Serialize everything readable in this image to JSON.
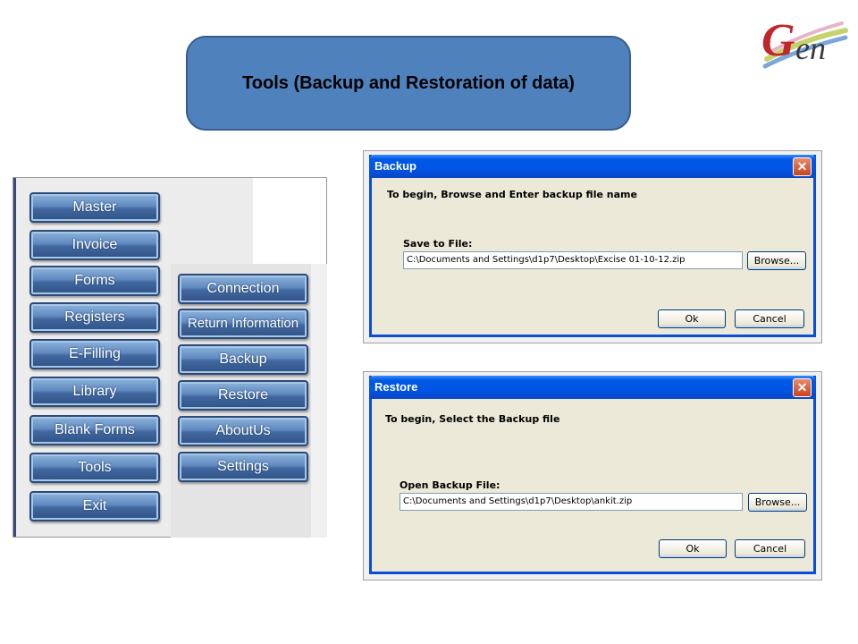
{
  "banner": {
    "title": "Tools (Backup and Restoration of data)"
  },
  "logo": {
    "text": "Gen"
  },
  "main_menu": {
    "items": [
      "Master",
      "Invoice",
      "Forms",
      "Registers",
      "E-Filling",
      "Library",
      "Blank Forms",
      "Tools",
      "Exit"
    ]
  },
  "tools_submenu": {
    "items": [
      "Connection",
      "Return Information",
      "Backup",
      "Restore",
      "AboutUs",
      "Settings"
    ]
  },
  "backup_dialog": {
    "title": "Backup",
    "instruction": "To begin, Browse and Enter backup file name",
    "field_label": "Save to File:",
    "field_value": "C:\\Documents and Settings\\d1p7\\Desktop\\Excise 01-10-12.zip",
    "browse_label": "Browse...",
    "ok_label": "Ok",
    "cancel_label": "Cancel",
    "close_label": "✕"
  },
  "restore_dialog": {
    "title": "Restore",
    "instruction": "To begin, Select the Backup file",
    "field_label": "Open Backup File:",
    "field_value": "C:\\Documents and Settings\\d1p7\\Desktop\\ankit.zip",
    "browse_label": "Browse...",
    "ok_label": "Ok",
    "cancel_label": "Cancel",
    "close_label": "✕"
  }
}
